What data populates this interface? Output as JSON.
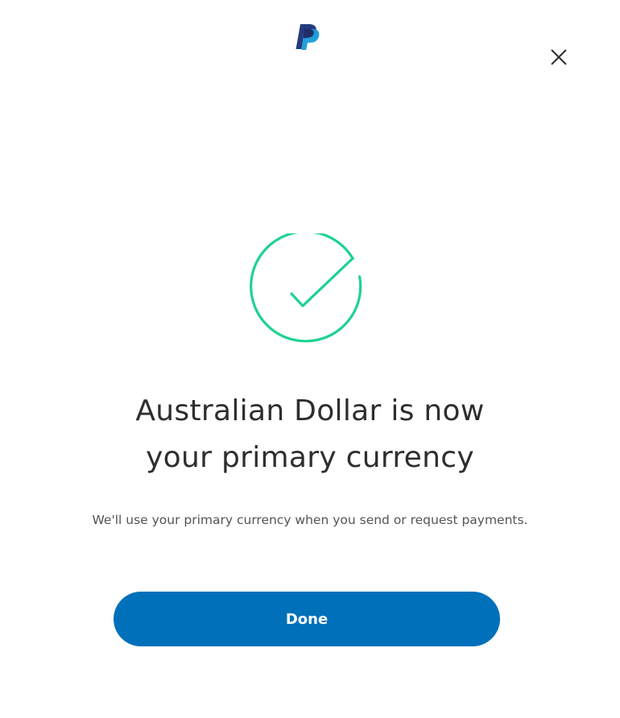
{
  "header": {
    "logo_icon": "paypal-logo-icon",
    "close_icon": "close-icon"
  },
  "success": {
    "icon": "check-circle-icon",
    "icon_color": "#1ed290",
    "title_line1": "Australian Dollar is now",
    "title_line2": "your primary currency",
    "description": "We'll use your primary currency when you send or request payments."
  },
  "actions": {
    "done_label": "Done",
    "done_color": "#0070ba"
  }
}
